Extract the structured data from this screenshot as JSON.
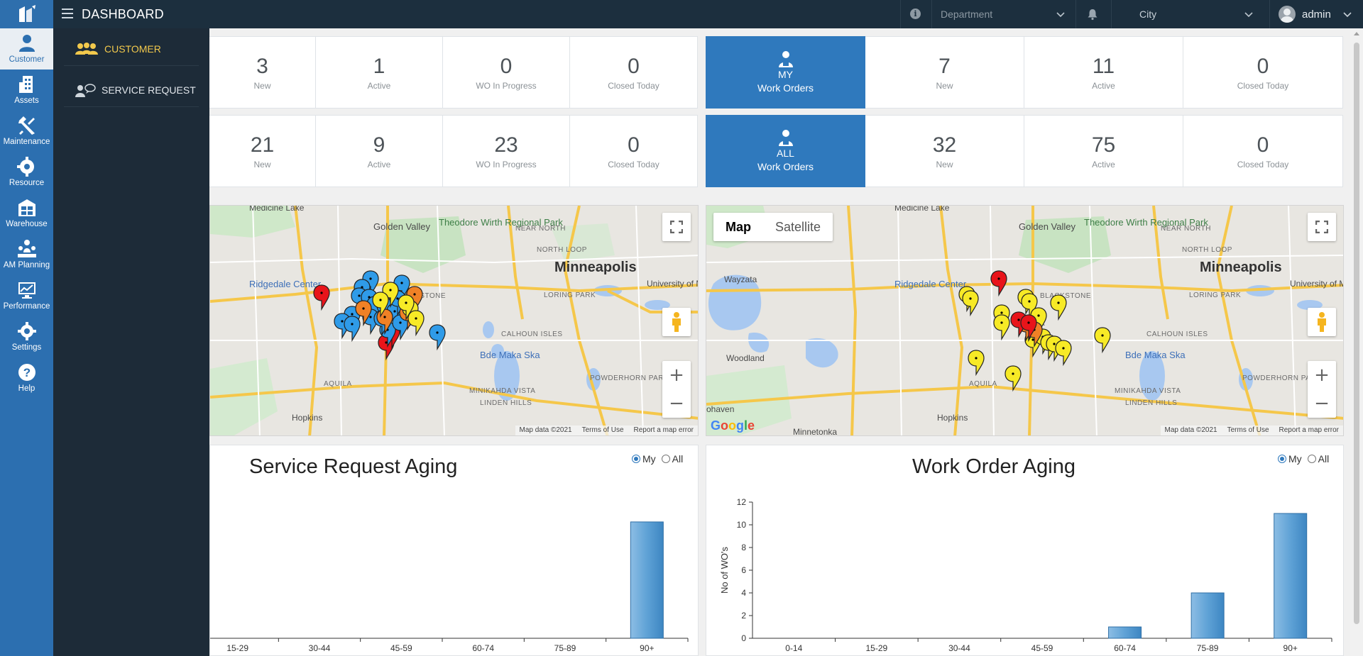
{
  "header": {
    "title": "DASHBOARD",
    "department_placeholder": "Department",
    "city_placeholder": "City",
    "user": "admin"
  },
  "rail": [
    {
      "label": "Customer",
      "icon": "customer-icon",
      "active": true
    },
    {
      "label": "Assets",
      "icon": "assets-icon"
    },
    {
      "label": "Maintenance",
      "icon": "maintenance-icon"
    },
    {
      "label": "Resource",
      "icon": "resource-icon"
    },
    {
      "label": "Warehouse",
      "icon": "warehouse-icon"
    },
    {
      "label": "AM Planning",
      "icon": "am-planning-icon"
    },
    {
      "label": "Performance",
      "icon": "performance-icon"
    },
    {
      "label": "Settings",
      "icon": "settings-icon"
    },
    {
      "label": "Help",
      "icon": "help-icon"
    }
  ],
  "submenu": [
    {
      "label": "CUSTOMER",
      "icon": "customer-group-icon",
      "active": true
    },
    {
      "label": "SERVICE REQUEST",
      "icon": "service-request-icon"
    }
  ],
  "stats": {
    "my_service_requests": [
      {
        "value": "3",
        "caption": "New"
      },
      {
        "value": "1",
        "caption": "Active"
      },
      {
        "value": "0",
        "caption": "WO In Progress"
      },
      {
        "value": "0",
        "caption": "Closed Today"
      }
    ],
    "all_service_requests": [
      {
        "value": "21",
        "caption": "New"
      },
      {
        "value": "9",
        "caption": "Active"
      },
      {
        "value": "23",
        "caption": "WO In Progress"
      },
      {
        "value": "0",
        "caption": "Closed Today"
      }
    ],
    "my_work_orders": {
      "line1": "MY",
      "line2": "Work Orders",
      "items": [
        {
          "value": "7",
          "caption": "New"
        },
        {
          "value": "11",
          "caption": "Active"
        },
        {
          "value": "0",
          "caption": "Closed Today"
        }
      ]
    },
    "all_work_orders": {
      "line1": "ALL",
      "line2": "Work Orders",
      "items": [
        {
          "value": "32",
          "caption": "New"
        },
        {
          "value": "75",
          "caption": "Active"
        },
        {
          "value": "0",
          "caption": "Closed Today"
        }
      ]
    }
  },
  "map": {
    "type_map": "Map",
    "type_satellite": "Satellite",
    "zoom_in": "+",
    "zoom_out": "−",
    "footer": {
      "data": "Map data ©2021",
      "terms": "Terms of Use",
      "report": "Report a map error"
    },
    "google": "Google",
    "labels": {
      "medicine_lake": "Medicine Lake",
      "golden_valley": "Golden Valley",
      "theodore_wirth": "Theodore Wirth Regional Park",
      "near_north": "NEAR NORTH",
      "north_loop": "NORTH LOOP",
      "minneapolis": "Minneapolis",
      "university": "University of Minnesota",
      "ridgedale": "Ridgedale Center",
      "loring_park": "LORING PARK",
      "blackstone": "BLACKSTONE",
      "calhoun_isles": "CALHOUN ISLES",
      "bde_maka_ska": "Bde Maka Ska",
      "powderhorn": "POWDERHORN PARK",
      "aquila": "AQUILA",
      "minikahda": "MINIKAHDA VISTA",
      "linden_hills": "LINDEN HILLS",
      "hopkins": "Hopkins",
      "wayzata": "Wayzata",
      "woodland": "Woodland",
      "shaven": "ohaven",
      "minnetonka": "Minnetonka",
      "park": "ark"
    }
  },
  "charts": {
    "radio_my": "My",
    "radio_all": "All"
  },
  "chart_data": [
    {
      "type": "bar",
      "title": "Service Request Aging",
      "categories": [
        "15-29",
        "30-44",
        "45-59",
        "60-74",
        "75-89",
        "90+"
      ],
      "values": [
        0,
        0,
        0,
        0,
        0,
        11
      ],
      "ylim": [
        0,
        12
      ],
      "xlabel": "",
      "ylabel": ""
    },
    {
      "type": "bar",
      "title": "Work Order Aging",
      "categories": [
        "0-14",
        "15-29",
        "30-44",
        "45-59",
        "60-74",
        "75-89",
        "90+"
      ],
      "values": [
        0,
        0,
        0,
        0,
        1,
        4,
        11
      ],
      "ylim": [
        0,
        12
      ],
      "yticks": [
        0,
        2,
        4,
        6,
        8,
        10,
        12
      ],
      "xlabel": "",
      "ylabel": "No of WO's"
    }
  ]
}
